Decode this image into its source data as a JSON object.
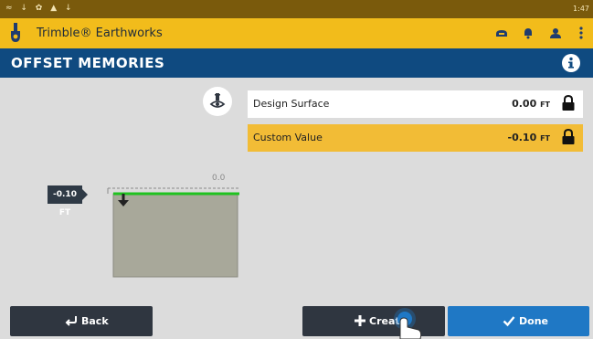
{
  "status_bar": {
    "icons": [
      "signal-icon",
      "download-icon",
      "settings-icon",
      "alert-icon",
      "download-icon"
    ],
    "time": "1:47"
  },
  "app_bar": {
    "title": "Trimble® Earthworks",
    "logo_icon": "shovel-icon",
    "icons": [
      "machine-icon",
      "bell-icon",
      "person-icon",
      "more-vert-icon"
    ],
    "accent_color": "#f2bc1b"
  },
  "title_bar": {
    "title": "OFFSET MEMORIES",
    "info_icon": "info-icon",
    "color": "#0f4a80"
  },
  "view_toggle_icon": "eye-layer-icon",
  "offsets": [
    {
      "label": "Design Surface",
      "value": "0.00",
      "unit": "FT",
      "locked": true,
      "selected": false
    },
    {
      "label": "Custom Value",
      "value": "-0.10",
      "unit": "FT",
      "locked": true,
      "selected": true
    }
  ],
  "diagram": {
    "offset_label": "-0.10 FT",
    "reference_label": "0.0",
    "surface_color": "#1fc21f",
    "ground_color": "#a8a89a"
  },
  "buttons": {
    "back": "Back",
    "create": "Create",
    "done": "Done"
  }
}
